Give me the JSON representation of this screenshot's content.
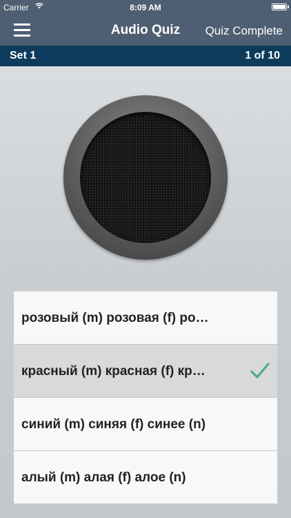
{
  "status_bar": {
    "carrier": "Carrier",
    "time": "8:09 AM",
    "wifi_icon": "wifi-icon",
    "battery_icon": "battery-icon"
  },
  "nav": {
    "title": "Audio Quiz",
    "right_button": "Quiz Complete",
    "menu_icon": "hamburger-menu-icon"
  },
  "set_bar": {
    "set_label": "Set 1",
    "progress": "1 of 10"
  },
  "speaker": {
    "icon": "speaker-icon"
  },
  "options": [
    {
      "label": "розовый (m)  розовая (f)  ро…",
      "selected": false
    },
    {
      "label": "красный (m)  красная (f)  кр…",
      "selected": true,
      "mark": "checkmark-icon"
    },
    {
      "label": "синий (m)  синяя (f)  синее (n)",
      "selected": false
    },
    {
      "label": "алый (m)  алая (f)  алое (n)",
      "selected": false
    }
  ],
  "colors": {
    "nav_bg": "#4f5f73",
    "set_bar_bg": "#0c3b5c",
    "check": "#4fa98a"
  }
}
